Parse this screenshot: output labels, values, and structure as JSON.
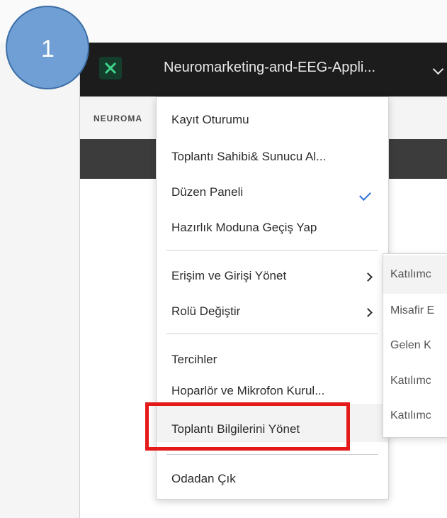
{
  "step": {
    "number": "1"
  },
  "app": {
    "room_title": "Neuromarketing-and-EEG-Appli...",
    "breadcrumb": "NEUROMA"
  },
  "menu": {
    "items": [
      {
        "label": "Kayıt Oturumu"
      },
      {
        "label": "Toplantı Sahibi& Sunucu Al..."
      },
      {
        "label": "Düzen Paneli",
        "checked": true
      },
      {
        "label": "Hazırlık Moduna Geçiş Yap"
      },
      {
        "label": "Erişim ve Girişi Yönet",
        "submenu": true
      },
      {
        "label": "Rolü Değiştir",
        "submenu": true
      },
      {
        "label": "Tercihler"
      },
      {
        "label": "Hoparlör ve Mikrofon Kurul..."
      },
      {
        "label": "Toplantı Bilgilerini Yönet",
        "highlighted": true
      },
      {
        "label": "Odadan Çık"
      }
    ]
  },
  "submenu": {
    "items": [
      {
        "label": "Katılımc"
      },
      {
        "label": "Misafir E"
      },
      {
        "label": "Gelen K"
      },
      {
        "label": "Katılımc"
      },
      {
        "label": "Katılımc"
      }
    ]
  },
  "colors": {
    "highlight": "#e41a1a",
    "check": "#2d6fd8",
    "titlebar": "#1c1c1c",
    "badge": "#6f9fd5"
  }
}
